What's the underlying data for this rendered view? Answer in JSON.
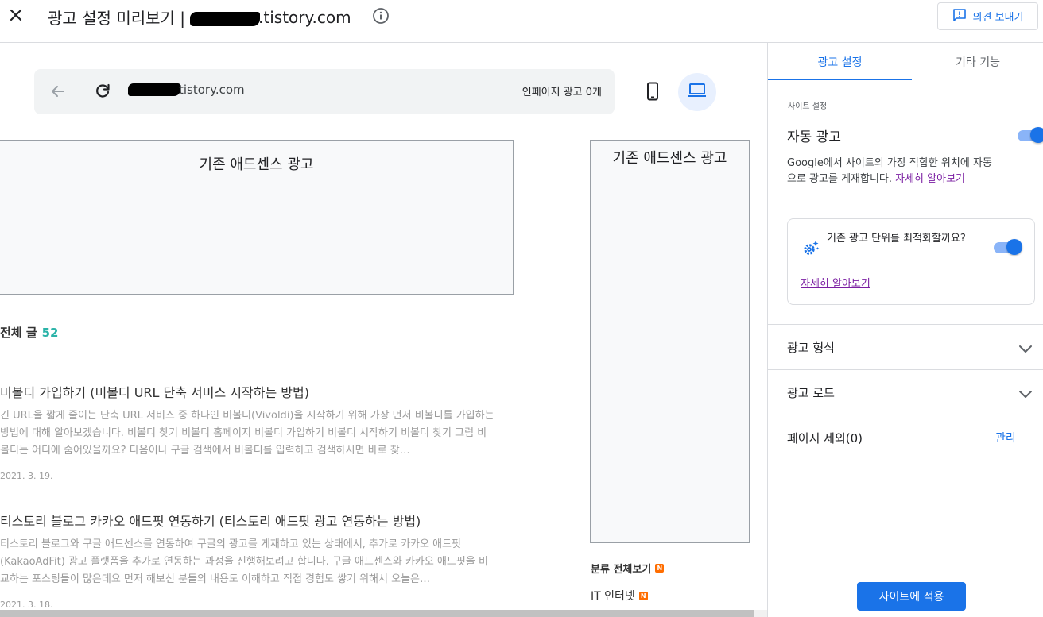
{
  "header": {
    "title_prefix": "광고 설정 미리보기 |",
    "title_domain": ".tistory.com",
    "feedback_label": "의견 보내기"
  },
  "preview": {
    "url_text": "tistory.com",
    "inpage_ads": "인페이지 광고 0개",
    "existing_ad_label": "기존 애드센스 광고",
    "all_posts_label": "전체 글",
    "all_posts_count": "52",
    "posts": [
      {
        "title": "비볼디 가입하기 (비볼디 URL 단축 서비스 시작하는 방법)",
        "excerpt": "긴 URL을 짧게 줄이는 단축 URL 서비스 중 하나인 비볼디(Vivoldi)을 시작하기 위해 가장 먼저 비볼디를 가입하는 방법에 대해 알아보겠습니다. 비볼디 찾기 비볼디 홈페이지 비볼디 가입하기 비볼디 시작하기 비볼디 찾기 그럼 비볼디는 어디에 숨어있을까요? 다음이나 구글 검색에서 비볼디를 입력하고 검색하시면 바로 찾…",
        "date": "2021. 3. 19."
      },
      {
        "title": "티스토리 블로그 카카오 애드핏 연동하기 (티스토리 애드핏 광고 연동하는 방법)",
        "excerpt": "티스토리 블로그와 구글 애드센스를 연동하여 구글의 광고를 게재하고 있는 상태에서, 추가로 카카오 애드핏(KakaoAdFit) 광고 플랫폼을 추가로 연동하는 과정을 진행해보려고 합니다. 구글 애드센스와 카카오 애드핏을 비교하는 포스팅들이 많은데요 먼저 해보신 분들의 내용도 이해하고 직접 경험도 쌓기 위해서 오늘은…",
        "date": "2021. 3. 18."
      }
    ],
    "category_head": "분류 전체보기",
    "category_item": "IT 인터넷",
    "new_badge": "N"
  },
  "panel": {
    "tabs": [
      "광고 설정",
      "기타 기능"
    ],
    "section_label": "사이트 설정",
    "auto_ads_title": "자동 광고",
    "auto_ads_enabled": true,
    "auto_ads_desc": "Google에서 사이트의 가장 적합한 위치에 자동으로 광고를 게재합니다. ",
    "learn_more": "자세히 알아보기",
    "optimize_text": "기존 광고 단위를 최적화할까요?",
    "optimize_enabled": true,
    "rows": {
      "ad_formats": "광고 형식",
      "ad_load": "광고 로드",
      "page_exclusions": "페이지 제외(0)",
      "manage": "관리"
    },
    "apply_label": "사이트에 적용"
  }
}
